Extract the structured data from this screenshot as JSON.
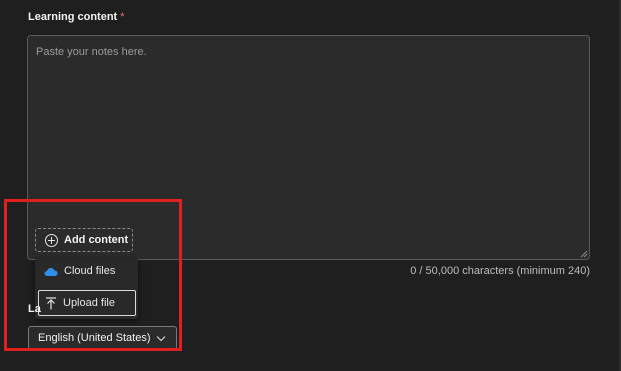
{
  "form": {
    "learning_content_label": "Learning content",
    "required_marker": "*",
    "textarea_placeholder": "Paste your notes here.",
    "char_counter": "0 / 50,000 characters (minimum 240)",
    "add_content_label": "Add content",
    "language_label": "La",
    "language_value": "English (United States)"
  },
  "add_menu": {
    "items": [
      {
        "label": "Cloud files",
        "icon": "cloud-icon"
      },
      {
        "label": "Upload file",
        "icon": "upload-icon"
      }
    ]
  },
  "colors": {
    "background": "#1f1f1f",
    "required": "#ff6b6b",
    "highlight": "#e02020",
    "cloud": "#2f8fe8"
  }
}
